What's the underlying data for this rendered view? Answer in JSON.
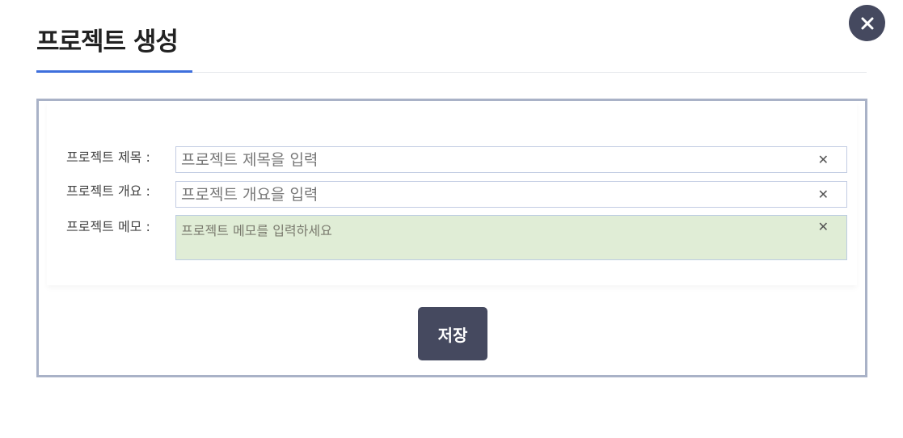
{
  "dialog": {
    "title": "프로젝트 생성",
    "close_icon": "close-icon"
  },
  "form": {
    "fields": [
      {
        "label": "프로젝트 제목 :",
        "placeholder": "프로젝트 제목을 입력",
        "value": "",
        "clear_glyph": "✕"
      },
      {
        "label": "프로젝트 개요 :",
        "placeholder": "프로젝트 개요을 입력",
        "value": "",
        "clear_glyph": "✕"
      },
      {
        "label": "프로젝트 메모 :",
        "placeholder": "프로젝트 메모를 입력하세요",
        "value": "",
        "clear_glyph": "✕"
      }
    ],
    "save_label": "저장"
  },
  "colors": {
    "accent": "#3e6fdc",
    "button_bg": "#45495f",
    "panel_border": "#a9b2c7",
    "memo_bg": "#e0edd6"
  }
}
